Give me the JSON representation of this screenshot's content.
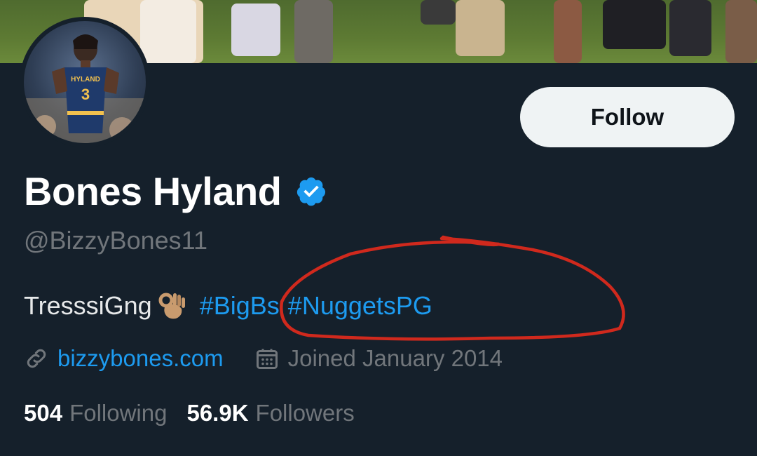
{
  "profile": {
    "display_name": "Bones Hyland",
    "handle": "@BizzyBones11",
    "verified_badge_icon": "verified-badge-icon",
    "bio": {
      "text": "TresssiGng",
      "emoji": "ok-hand-emoji",
      "hashtags": [
        "#BigBs",
        "#NuggetsPG"
      ]
    },
    "website": "bizzybones.com",
    "joined": "Joined January 2014",
    "stats": {
      "following_count": "504",
      "following_label": "Following",
      "followers_count": "56.9K",
      "followers_label": "Followers"
    },
    "avatar_jersey": {
      "name": "HYLAND",
      "number": "3"
    }
  },
  "actions": {
    "follow_label": "Follow"
  },
  "colors": {
    "background": "#15202b",
    "accent": "#1d9bf0",
    "secondary_text": "#71767b",
    "annotation": "#d0291d"
  }
}
